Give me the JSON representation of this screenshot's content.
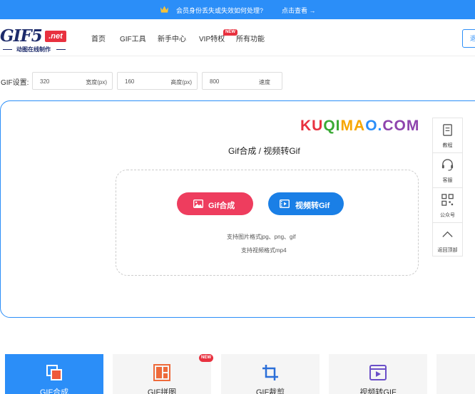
{
  "banner": {
    "icon": "crown-icon",
    "text": "会员身份丢失或失效如何处理?",
    "link": "点击查看 →",
    "color": "#2b8ef8"
  },
  "header": {
    "logo": {
      "main": "GIF5",
      "badge": ".net",
      "tagline": "动图在线制作"
    },
    "nav": [
      "首页",
      "GIF工具",
      "新手中心",
      "VIP特权",
      "所有功能"
    ],
    "new_badge": "NEW",
    "right_button": "退"
  },
  "settings": {
    "label": "GIF设置:",
    "width": {
      "value": "320",
      "unit": "宽度(px)"
    },
    "height": {
      "value": "160",
      "unit": "高度(px)"
    },
    "speed": {
      "value": "800",
      "unit": "速度"
    }
  },
  "watermark": [
    "KU",
    "QI",
    "MA",
    "O.",
    "COM"
  ],
  "main": {
    "title": "Gif合成 / 视频转Gif",
    "buttons": {
      "gif_compose": "Gif合成",
      "video_to_gif": "视频转Gif"
    },
    "hints": [
      "支持图片格式jpg、png、gif",
      "支持视频格式mp4"
    ]
  },
  "side_toolbar": [
    {
      "label": "教程",
      "icon": "book-icon"
    },
    {
      "label": "客服",
      "icon": "headset-icon"
    },
    {
      "label": "公众号",
      "icon": "qrcode-icon"
    },
    {
      "label": "返回顶部",
      "icon": "arrow-up-icon"
    }
  ],
  "tools": [
    {
      "label": "GIF合成",
      "icon": "compose-icon",
      "active": true
    },
    {
      "label": "GIF拼图",
      "icon": "grid-icon",
      "active": false,
      "badge": "NEW"
    },
    {
      "label": "GIF裁剪",
      "icon": "crop-icon",
      "active": false
    },
    {
      "label": "视频转GIF",
      "icon": "video-icon",
      "active": false
    }
  ],
  "colors": {
    "accent": "#2b8ef8",
    "red_button": "#ee3d5e",
    "blue_button": "#1a7fe6",
    "badge": "#e8313f"
  }
}
